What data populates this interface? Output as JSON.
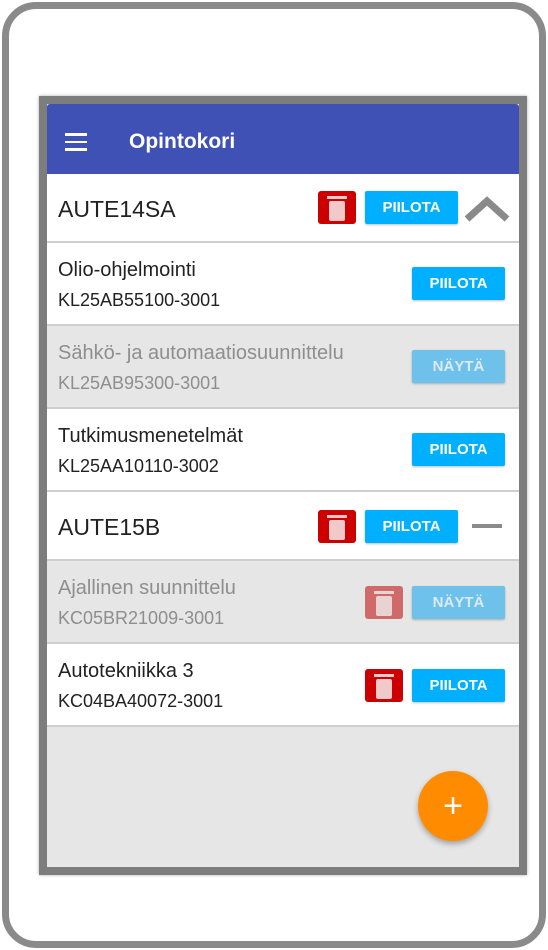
{
  "appbar": {
    "title": "Opintokori"
  },
  "groups": [
    {
      "name": "AUTE14SA",
      "toggle": "PIILOTA",
      "expand": "collapse",
      "items": [
        {
          "name": "Olio-ohjelmointi",
          "code": "KL25AB55100-3001",
          "toggle": "PIILOTA"
        },
        {
          "name": "Sähkö- ja automaatiosuunnittelu",
          "code": "KL25AB95300-3001",
          "toggle": "NÄYTÄ"
        },
        {
          "name": "Tutkimusmenetelmät",
          "code": "KL25AA10110-3002",
          "toggle": "PIILOTA"
        }
      ]
    },
    {
      "name": "AUTE15B",
      "toggle": "PIILOTA",
      "expand": "minus",
      "items": [
        {
          "name": "Ajallinen suunnittelu",
          "code": "KC05BR21009-3001",
          "toggle": "NÄYTÄ"
        },
        {
          "name": "Autotekniikka 3",
          "code": "KC04BA40072-3001",
          "toggle": "PIILOTA"
        }
      ]
    }
  ],
  "fab": "+",
  "colors": {
    "primary": "#3f51b5",
    "button": "#00b0ff",
    "delete": "#cc0000",
    "fab": "#ff8c00"
  }
}
